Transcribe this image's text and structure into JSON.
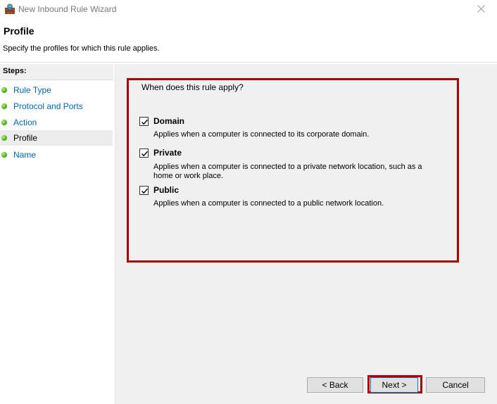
{
  "window": {
    "title": "New Inbound Rule Wizard",
    "icon": "firewall-icon",
    "close_icon": "close-icon"
  },
  "header": {
    "title": "Profile",
    "description": "Specify the profiles for which this rule applies."
  },
  "steps": {
    "title": "Steps:",
    "items": [
      {
        "label": "Rule Type",
        "active": false
      },
      {
        "label": "Protocol and Ports",
        "active": false
      },
      {
        "label": "Action",
        "active": false
      },
      {
        "label": "Profile",
        "active": true
      },
      {
        "label": "Name",
        "active": false
      }
    ]
  },
  "main": {
    "question": "When does this rule apply?",
    "options": [
      {
        "label": "Domain",
        "checked": true,
        "description": "Applies when a computer is connected to its corporate domain."
      },
      {
        "label": "Private",
        "checked": true,
        "description": "Applies when a computer is connected to a private network location, such as a home or work place."
      },
      {
        "label": "Public",
        "checked": true,
        "description": "Applies when a computer is connected to a public network location."
      }
    ]
  },
  "buttons": {
    "back": "< Back",
    "next": "Next >",
    "cancel": "Cancel"
  },
  "colors": {
    "highlight": "#b30000",
    "link": "#0066cc",
    "step_dot": "#4fb51d"
  }
}
